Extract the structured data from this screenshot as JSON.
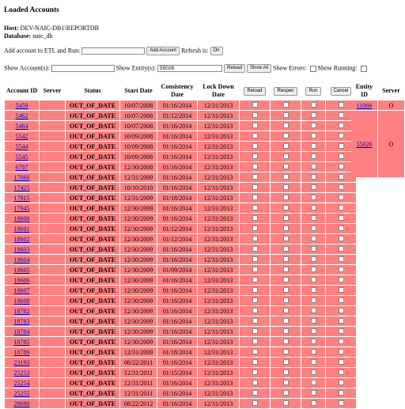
{
  "page": {
    "title": "Loaded Accounts"
  },
  "host": {
    "host_label": "Host:",
    "host_value": "DEV-NAIC-DB1\\REPORTDB",
    "db_label": "Database:",
    "db_value": "naic_dh"
  },
  "add_account": {
    "label": "Add account to ETL and Run:",
    "input_value": "",
    "button": "Add Account",
    "refresh_label": "Refresh is:",
    "refresh_button": "On"
  },
  "filters": {
    "show_accounts_label": "Show Account(s):",
    "show_accounts_value": "",
    "show_entity_label": "Show Entity(s):",
    "show_entity_value": "55026",
    "reload_button": "Reload",
    "show_all_button": "Show All",
    "show_errors_label": "Show Errors:",
    "show_running_label": "Show Running:"
  },
  "table": {
    "headers": {
      "account_id": "Account ID",
      "server": "Server",
      "status": "Status",
      "start_date": "Start Date",
      "consistency_date": "Consistency Date",
      "lock_down_date": "Lock Down Date"
    },
    "action_buttons": {
      "reload": "Reload",
      "reopen": "Reopen",
      "run": "Run",
      "cancel": "Cancel"
    },
    "rows": [
      {
        "id": "5459",
        "server": "",
        "status": "OUT_OF_DATE",
        "start": "10/07/2008",
        "consistency": "01/16/2014",
        "lockdown": "12/31/2013"
      },
      {
        "id": "5462",
        "server": "",
        "status": "OUT_OF_DATE",
        "start": "10/07/2008",
        "consistency": "01/12/2014",
        "lockdown": "12/31/2013"
      },
      {
        "id": "5464",
        "server": "",
        "status": "OUT_OF_DATE",
        "start": "10/07/2008",
        "consistency": "01/16/2014",
        "lockdown": "12/31/2013"
      },
      {
        "id": "5542",
        "server": "",
        "status": "OUT_OF_DATE",
        "start": "10/09/2008",
        "consistency": "01/16/2014",
        "lockdown": "12/31/2013"
      },
      {
        "id": "5544",
        "server": "",
        "status": "OUT_OF_DATE",
        "start": "10/09/2008",
        "consistency": "01/16/2014",
        "lockdown": "12/31/2013"
      },
      {
        "id": "5545",
        "server": "",
        "status": "OUT_OF_DATE",
        "start": "10/09/2008",
        "consistency": "01/16/2014",
        "lockdown": "12/31/2013"
      },
      {
        "id": "6787",
        "server": "",
        "status": "OUT_OF_DATE",
        "start": "12/30/2008",
        "consistency": "01/16/2014",
        "lockdown": "12/31/2013"
      },
      {
        "id": "17060",
        "server": "",
        "status": "OUT_OF_DATE",
        "start": "12/31/2009",
        "consistency": "01/16/2014",
        "lockdown": "12/31/2013"
      },
      {
        "id": "17425",
        "server": "",
        "status": "OUT_OF_DATE",
        "start": "10/10/2010",
        "consistency": "01/16/2014",
        "lockdown": "12/31/2013"
      },
      {
        "id": "17915",
        "server": "",
        "status": "OUT_OF_DATE",
        "start": "12/31/2009",
        "consistency": "01/18/2014",
        "lockdown": "12/31/2013"
      },
      {
        "id": "17945",
        "server": "",
        "status": "OUT_OF_DATE",
        "start": "12/30/2009",
        "consistency": "01/16/2014",
        "lockdown": "12/31/2013"
      },
      {
        "id": "18600",
        "server": "",
        "status": "OUT_OF_DATE",
        "start": "12/30/2009",
        "consistency": "01/16/2014",
        "lockdown": "12/31/2013"
      },
      {
        "id": "18601",
        "server": "",
        "status": "OUT_OF_DATE",
        "start": "12/30/2009",
        "consistency": "01/12/2014",
        "lockdown": "12/31/2013"
      },
      {
        "id": "18602",
        "server": "",
        "status": "OUT_OF_DATE",
        "start": "12/30/2009",
        "consistency": "01/12/2014",
        "lockdown": "12/31/2013"
      },
      {
        "id": "18603",
        "server": "",
        "status": "OUT_OF_DATE",
        "start": "12/30/2009",
        "consistency": "01/16/2014",
        "lockdown": "12/31/2013"
      },
      {
        "id": "18604",
        "server": "",
        "status": "OUT_OF_DATE",
        "start": "12/30/2009",
        "consistency": "01/16/2014",
        "lockdown": "12/31/2013"
      },
      {
        "id": "18605",
        "server": "",
        "status": "OUT_OF_DATE",
        "start": "12/30/2009",
        "consistency": "01/09/2014",
        "lockdown": "12/31/2013"
      },
      {
        "id": "18606",
        "server": "",
        "status": "OUT_OF_DATE",
        "start": "12/30/2009",
        "consistency": "01/16/2014",
        "lockdown": "12/31/2013"
      },
      {
        "id": "18607",
        "server": "",
        "status": "OUT_OF_DATE",
        "start": "12/30/2009",
        "consistency": "01/16/2014",
        "lockdown": "12/31/2013"
      },
      {
        "id": "18608",
        "server": "",
        "status": "OUT_OF_DATE",
        "start": "12/30/2009",
        "consistency": "01/16/2014",
        "lockdown": "12/31/2013"
      },
      {
        "id": "18782",
        "server": "",
        "status": "OUT_OF_DATE",
        "start": "12/30/2009",
        "consistency": "01/16/2014",
        "lockdown": "12/31/2013"
      },
      {
        "id": "18783",
        "server": "",
        "status": "OUT_OF_DATE",
        "start": "12/30/2009",
        "consistency": "01/16/2014",
        "lockdown": "12/31/2013"
      },
      {
        "id": "18784",
        "server": "",
        "status": "OUT_OF_DATE",
        "start": "12/30/2009",
        "consistency": "01/16/2014",
        "lockdown": "12/31/2013"
      },
      {
        "id": "18785",
        "server": "",
        "status": "OUT_OF_DATE",
        "start": "12/30/2009",
        "consistency": "01/16/2014",
        "lockdown": "12/31/2013"
      },
      {
        "id": "18789",
        "server": "",
        "status": "OUT_OF_DATE",
        "start": "12/31/2009",
        "consistency": "01/18/2014",
        "lockdown": "12/31/2013"
      },
      {
        "id": "23193",
        "server": "",
        "status": "OUT_OF_DATE",
        "start": "08/22/2011",
        "consistency": "01/16/2014",
        "lockdown": "12/31/2013"
      },
      {
        "id": "25253",
        "server": "",
        "status": "OUT_OF_DATE",
        "start": "12/31/2011",
        "consistency": "01/15/2014",
        "lockdown": "12/31/2013"
      },
      {
        "id": "25254",
        "server": "",
        "status": "OUT_OF_DATE",
        "start": "12/31/2011",
        "consistency": "01/16/2014",
        "lockdown": "12/31/2013"
      },
      {
        "id": "25255",
        "server": "",
        "status": "OUT_OF_DATE",
        "start": "12/31/2011",
        "consistency": "01/16/2014",
        "lockdown": "12/31/2013"
      },
      {
        "id": "28690",
        "server": "",
        "status": "OUT_OF_DATE",
        "start": "08/22/2012",
        "consistency": "01/16/2014",
        "lockdown": "12/31/2013"
      }
    ]
  },
  "side_table": {
    "headers": {
      "entity_id": "Entity ID",
      "server": "Server"
    },
    "rows": [
      {
        "id": "11066",
        "server": "O"
      },
      {
        "id": "55026",
        "server": "O"
      }
    ]
  },
  "colors": {
    "row_background": "#ff8080",
    "link": "#0000cc"
  }
}
